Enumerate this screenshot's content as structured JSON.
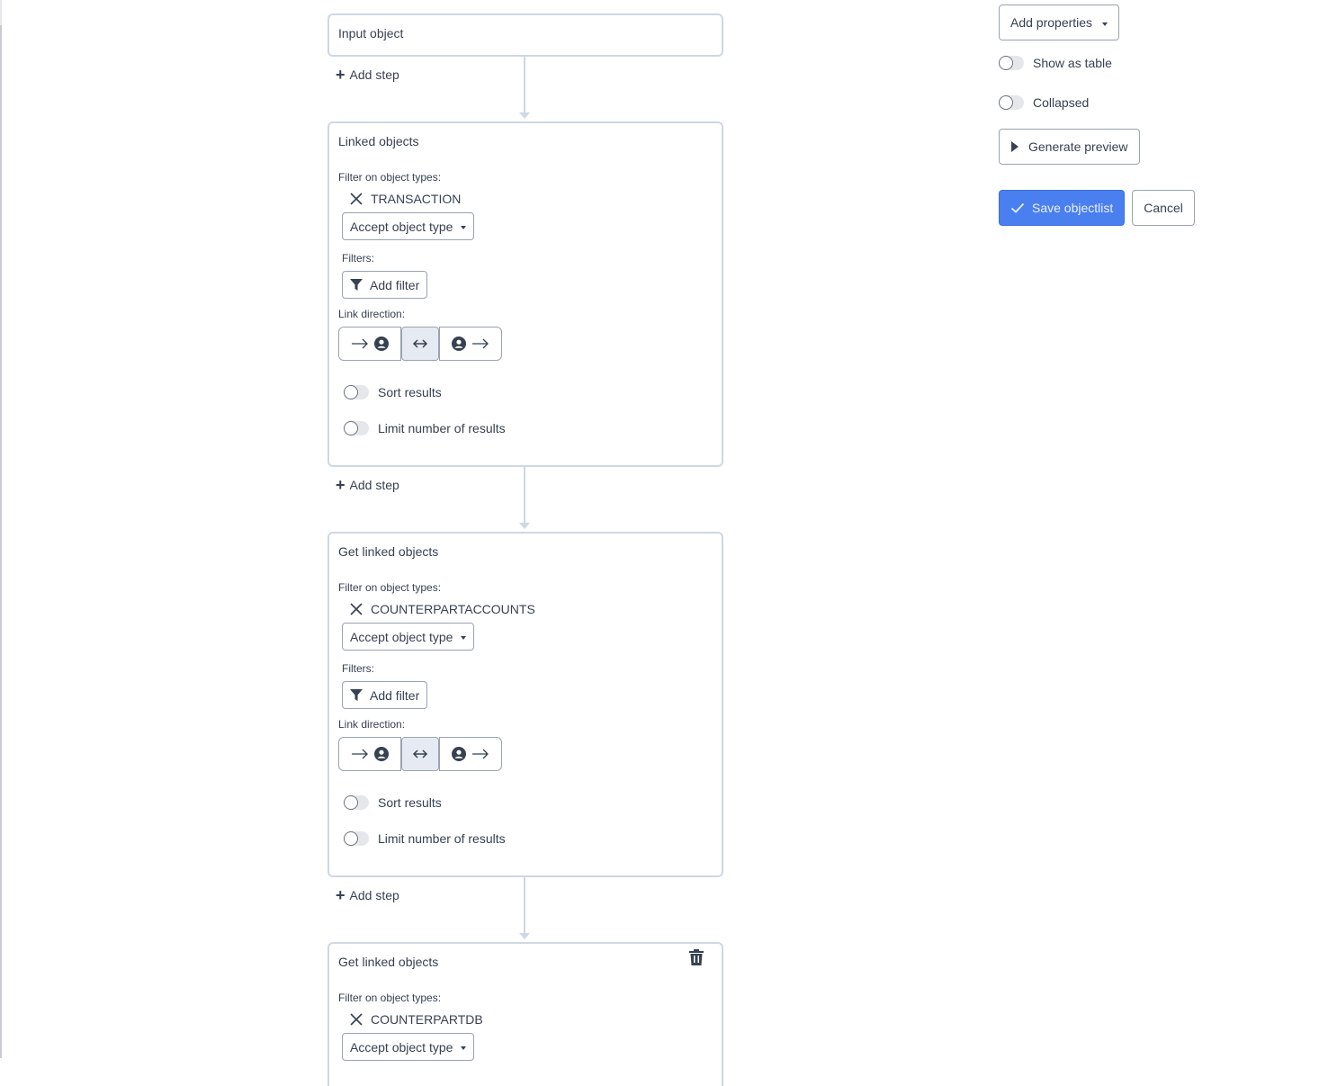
{
  "flow": {
    "input_card": {
      "title": "Input object"
    },
    "add_step_label": "Add step",
    "steps": [
      {
        "title": "Linked objects",
        "filter_on_object_types_label": "Filter on object types:",
        "object_type": "TRANSACTION",
        "accept_object_type_label": "Accept object type",
        "filters_label": "Filters:",
        "add_filter_label": "Add filter",
        "link_direction_label": "Link direction:",
        "link_direction_selected": "both",
        "sort_results_label": "Sort results",
        "sort_results_on": false,
        "limit_results_label": "Limit number of results",
        "limit_results_on": false
      },
      {
        "title": "Get linked objects",
        "filter_on_object_types_label": "Filter on object types:",
        "object_type": "COUNTERPARTACCOUNTS",
        "accept_object_type_label": "Accept object type",
        "filters_label": "Filters:",
        "add_filter_label": "Add filter",
        "link_direction_label": "Link direction:",
        "link_direction_selected": "both",
        "sort_results_label": "Sort results",
        "sort_results_on": false,
        "limit_results_label": "Limit number of results",
        "limit_results_on": false
      },
      {
        "title": "Get linked objects",
        "filter_on_object_types_label": "Filter on object types:",
        "object_type": "COUNTERPARTDB",
        "accept_object_type_label": "Accept object type"
      }
    ]
  },
  "sidebar": {
    "add_properties_label": "Add properties",
    "show_as_table_label": "Show as table",
    "show_as_table_on": false,
    "collapsed_label": "Collapsed",
    "collapsed_on": false,
    "generate_preview_label": "Generate preview",
    "save_label": "Save objectlist",
    "cancel_label": "Cancel"
  },
  "colors": {
    "primary": "#4a7ff0",
    "border": "#cfd8e3",
    "selected_direction_bg": "#e6eaf2",
    "text": "#374151"
  }
}
